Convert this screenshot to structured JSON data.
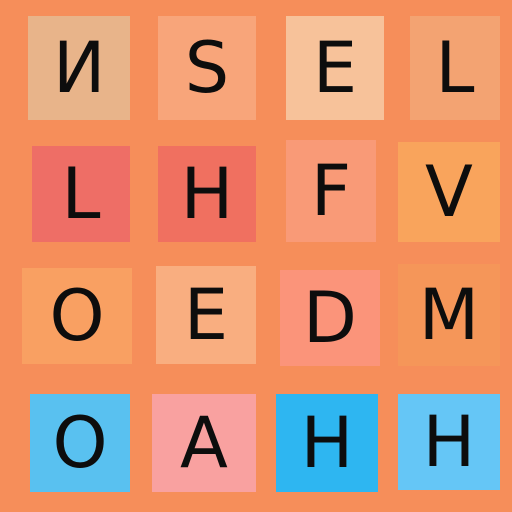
{
  "board": {
    "tiles": [
      {
        "letter": "N",
        "color": "#E8B48A"
      },
      {
        "letter": "S",
        "color": "#F8A57A"
      },
      {
        "letter": "E",
        "color": "#F7C29A"
      },
      {
        "letter": "L",
        "color": "#F3A372"
      },
      {
        "letter": "L",
        "color": "#EE6E66"
      },
      {
        "letter": "H",
        "color": "#F07060"
      },
      {
        "letter": "F",
        "color": "#F99A77"
      },
      {
        "letter": "V",
        "color": "#F9A45C"
      },
      {
        "letter": "O",
        "color": "#F9A062"
      },
      {
        "letter": "E",
        "color": "#F9AE80"
      },
      {
        "letter": "D",
        "color": "#FB947A"
      },
      {
        "letter": "M",
        "color": "#F59659"
      },
      {
        "letter": "O",
        "color": "#59C1F0"
      },
      {
        "letter": "A",
        "color": "#F9A1A0"
      },
      {
        "letter": "H",
        "color": "#2EB6F1"
      },
      {
        "letter": "H",
        "color": "#65C6F6"
      }
    ]
  }
}
